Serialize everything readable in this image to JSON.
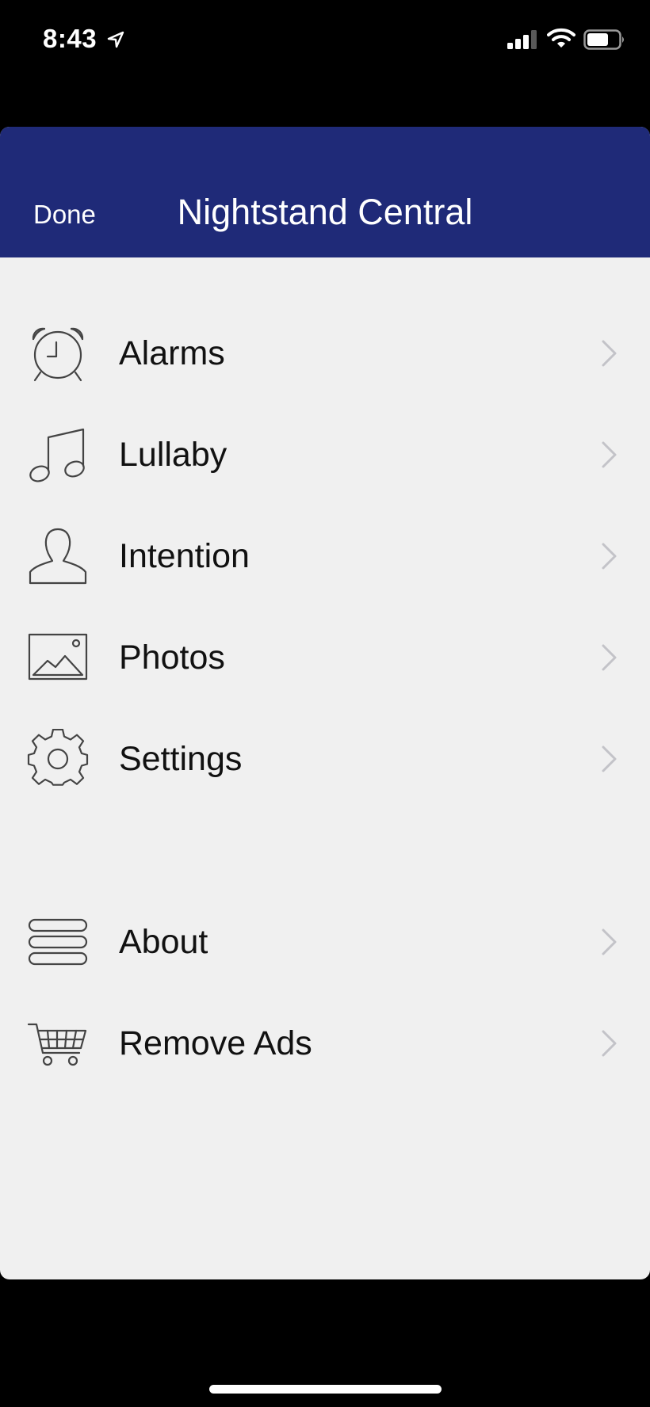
{
  "status_bar": {
    "time": "8:43",
    "icons": [
      "location-arrow-icon",
      "cellular-signal-icon",
      "wifi-icon",
      "battery-icon"
    ]
  },
  "nav": {
    "done_label": "Done",
    "title": "Nightstand Central",
    "background_color": "#1f2a78"
  },
  "menu": {
    "items": [
      {
        "label": "Alarms",
        "icon": "alarm-clock-icon"
      },
      {
        "label": "Lullaby",
        "icon": "music-note-icon"
      },
      {
        "label": "Intention",
        "icon": "person-icon"
      },
      {
        "label": "Photos",
        "icon": "photo-icon"
      },
      {
        "label": "Settings",
        "icon": "gear-icon"
      },
      {
        "label": "About",
        "icon": "list-icon"
      },
      {
        "label": "Remove Ads",
        "icon": "shopping-cart-icon"
      }
    ]
  }
}
